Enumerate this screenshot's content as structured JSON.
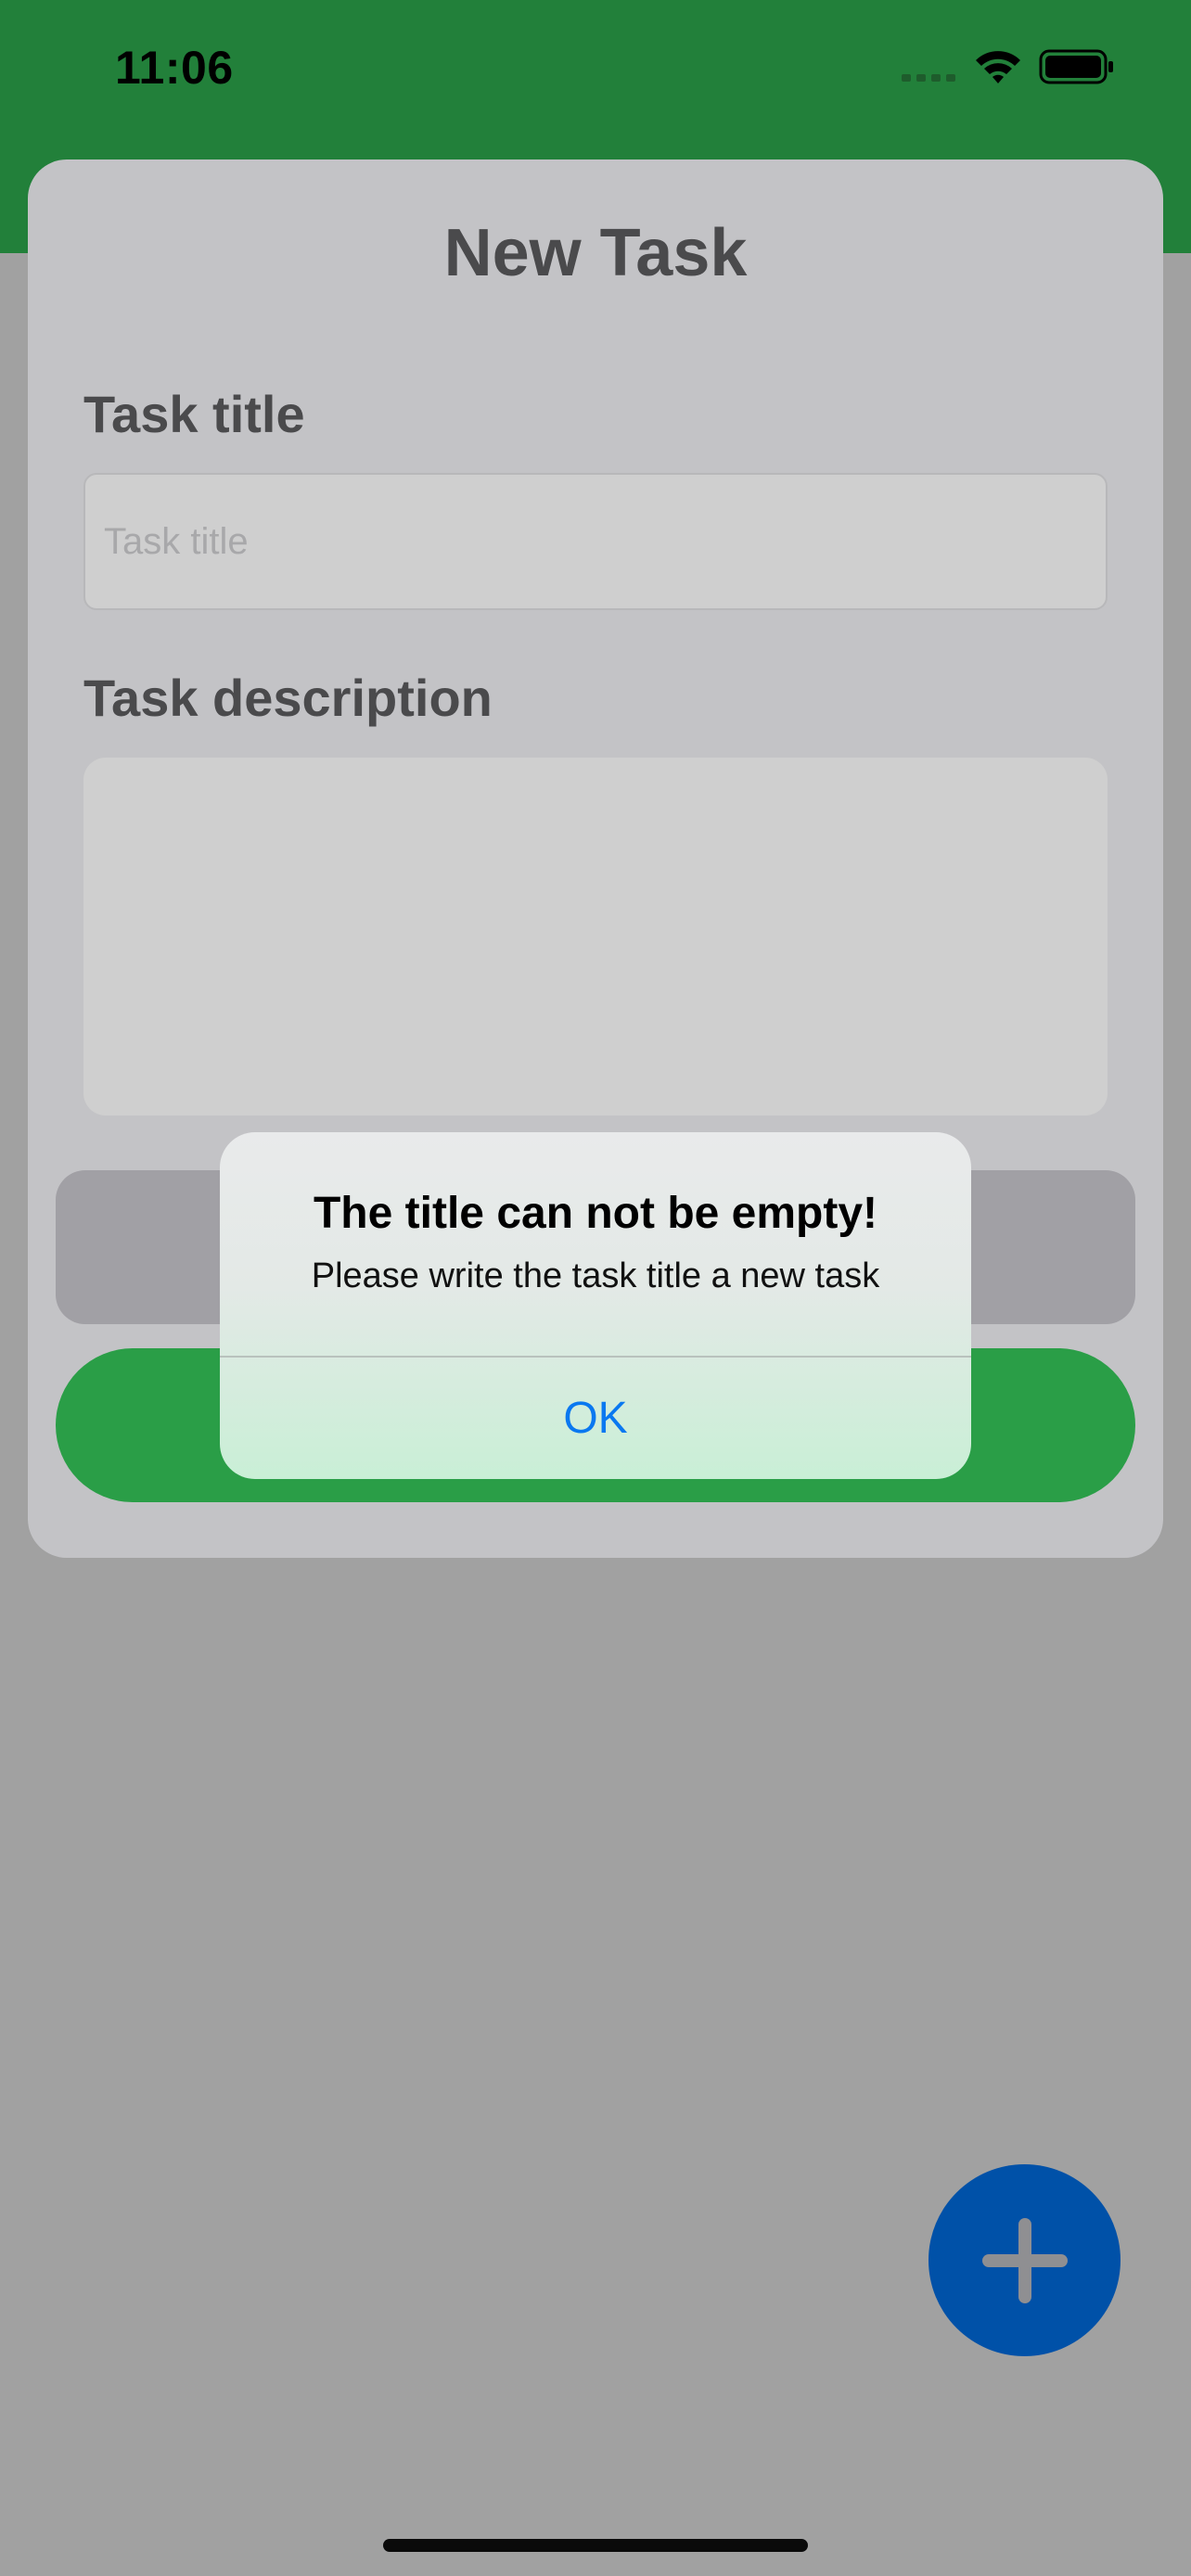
{
  "status_bar": {
    "time": "11:06"
  },
  "sheet": {
    "title": "New Task",
    "title_field": {
      "label": "Task title",
      "placeholder": "Task title",
      "value": ""
    },
    "description_field": {
      "label": "Task description",
      "value": ""
    }
  },
  "alert": {
    "title": "The title can not be empty!",
    "message": "Please write the task title a new task",
    "ok_label": "OK"
  },
  "fab": {
    "icon": "plus-icon"
  },
  "colors": {
    "header_green": "#22803a",
    "save_green": "#2a9e47",
    "fab_blue": "#0051a8",
    "link_blue": "#0a78f0"
  }
}
